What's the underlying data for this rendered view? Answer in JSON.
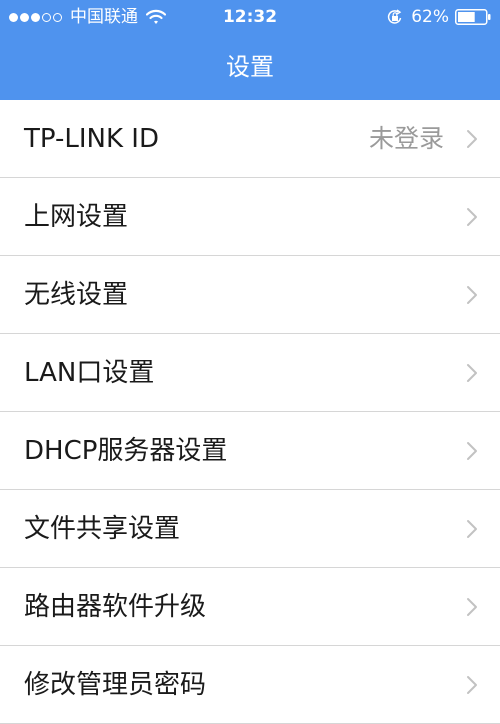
{
  "status_bar": {
    "signal_filled": 3,
    "signal_total": 5,
    "carrier": "中国联通",
    "time": "12:32",
    "battery_percent": "62%",
    "battery_level": 0.62,
    "icons": [
      "wifi-icon",
      "orientation-lock-icon",
      "battery-icon"
    ]
  },
  "nav": {
    "title": "设置"
  },
  "settings": {
    "items": [
      {
        "label": "TP-LINK ID",
        "value": "未登录"
      },
      {
        "label": "上网设置"
      },
      {
        "label": "无线设置"
      },
      {
        "label": "LAN口设置"
      },
      {
        "label": "DHCP服务器设置"
      },
      {
        "label": "文件共享设置"
      },
      {
        "label": "路由器软件升级"
      },
      {
        "label": "修改管理员密码"
      }
    ]
  },
  "colors": {
    "header_bg": "#4f93ee",
    "text_primary": "#1a1a1a",
    "text_secondary": "#9a9a9a",
    "separator": "#d6d6d6",
    "chevron": "#c2c2c2"
  }
}
